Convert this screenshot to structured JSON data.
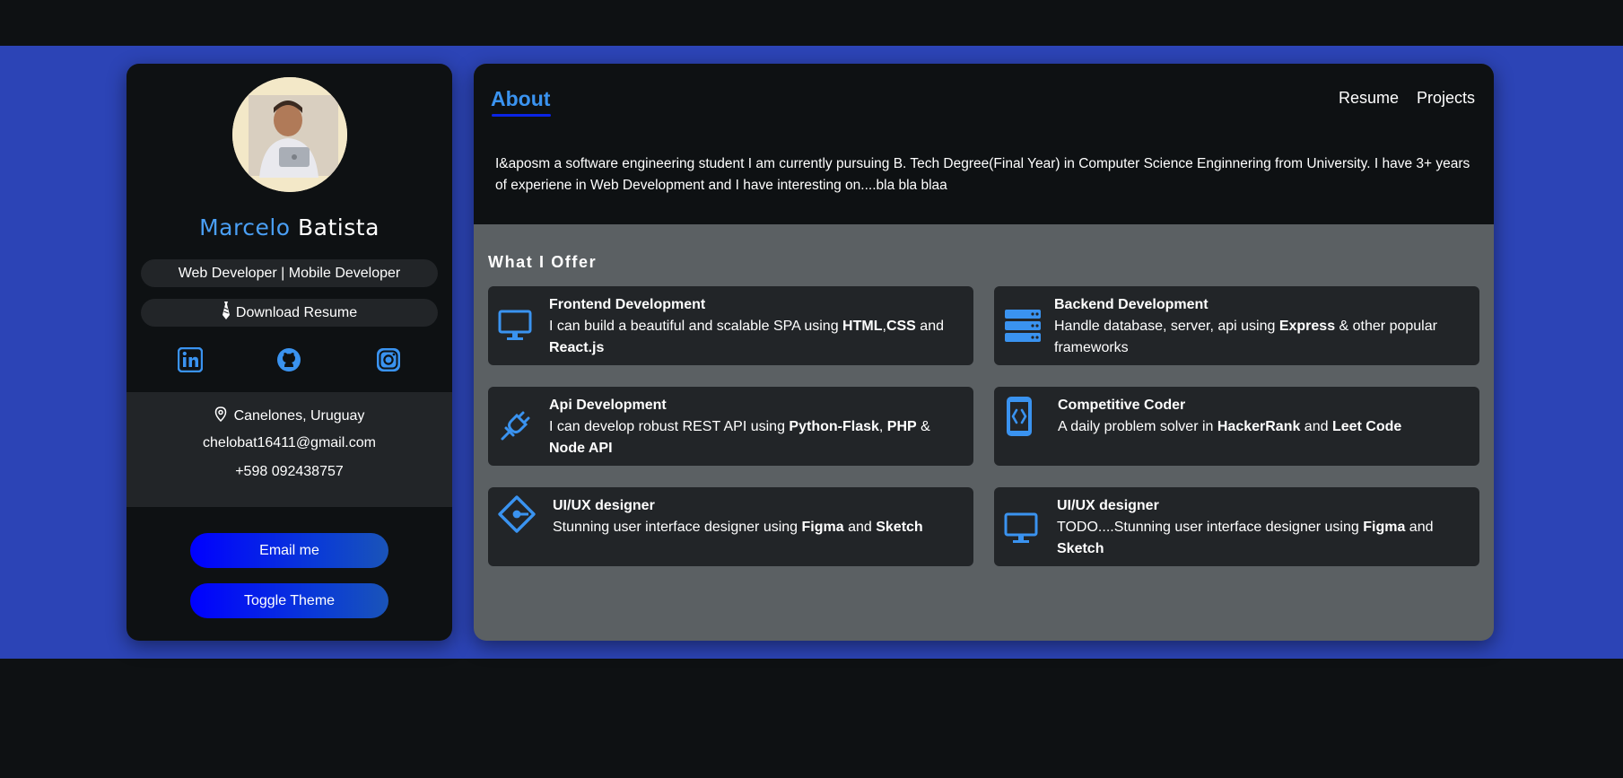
{
  "profile": {
    "first_name": "Marcelo",
    "last_name": "Batista",
    "role": "Web Developer | Mobile Developer",
    "download_label": "Download Resume",
    "socials": [
      "linkedin-icon",
      "github-icon",
      "instagram-icon"
    ],
    "location": "Canelones, Uruguay",
    "email": "chelobat16411@gmail.com",
    "phone": "+598 092438757",
    "email_button": "Email me",
    "theme_button": "Toggle Theme"
  },
  "header": {
    "title": "About",
    "nav": [
      "Resume",
      "Projects"
    ]
  },
  "about": {
    "text": "I&aposm a software engineering student I am currently pursuing B. Tech Degree(Final Year) in Computer Science Enginnering from University. I have 3+ years of experiene in Web Development and I have interesting on....bla bla blaa"
  },
  "offers": {
    "title": "What I Offer",
    "items": [
      {
        "icon": "monitor-icon",
        "title": "Frontend Development",
        "d1": "I can build a beautiful and scalable SPA using ",
        "b1": "HTML",
        "d2": ",",
        "b2": "CSS",
        "d3": " and ",
        "b3": "React.js",
        "d4": ""
      },
      {
        "icon": "server-icon",
        "title": "Backend Development",
        "d1": "Handle database, server, api using ",
        "b1": "Express",
        "d2": " & other popular frameworks",
        "b2": "",
        "d3": "",
        "b3": "",
        "d4": ""
      },
      {
        "icon": "plug-icon",
        "title": "Api Development",
        "d1": "I can develop robust REST API using ",
        "b1": "Python-Flask",
        "d2": ", ",
        "b2": "PHP",
        "d3": " & ",
        "b3": "Node API",
        "d4": ""
      },
      {
        "icon": "code-phone-icon",
        "title": "Competitive Coder",
        "d1": "A daily problem solver in ",
        "b1": "HackerRank",
        "d2": " and ",
        "b2": "Leet Code",
        "d3": "",
        "b3": "",
        "d4": ""
      },
      {
        "icon": "design-diamond-icon",
        "title": "UI/UX designer",
        "d1": "Stunning user interface designer using ",
        "b1": "Figma",
        "d2": " and ",
        "b2": "Sketch",
        "d3": "",
        "b3": "",
        "d4": ""
      },
      {
        "icon": "monitor-icon",
        "title": "UI/UX designer",
        "d1": "TODO....Stunning user interface designer using ",
        "b1": "Figma",
        "d2": " and ",
        "b2": "Sketch",
        "d3": "",
        "b3": "",
        "d4": ""
      }
    ]
  },
  "colors": {
    "accent": "#3a93f0",
    "band": "#2c44b6",
    "panel": "#0e1113",
    "card": "#222528",
    "offer_bg": "#5b6063"
  }
}
